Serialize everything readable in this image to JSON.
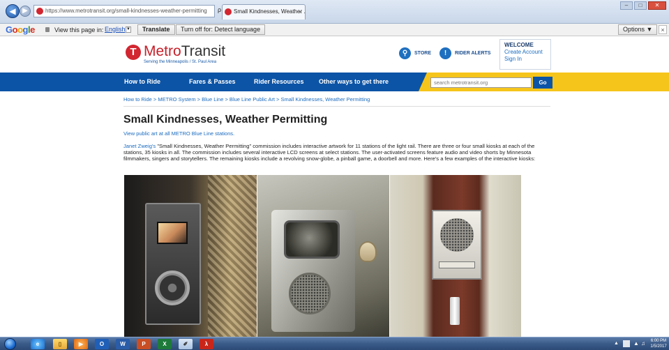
{
  "browser": {
    "url": "https://www.metrotransit.org/small-kindnesses-weather-permitting",
    "address_tools": "ρ ▾ ▩ C",
    "tab_title": "Small Kindnesses, Weather ...",
    "tab_close": "×"
  },
  "translate_bar": {
    "view_label": "View this page in:",
    "language": "English",
    "translate_button": "Translate",
    "turnoff_button": "Turn off for: Detect language",
    "options_button": "Options ▼",
    "close": "×"
  },
  "header": {
    "logo_part1": "Metro",
    "logo_part2": "Transit",
    "logo_letter": "T",
    "tagline": "Serving the Minneapolis / St. Paul Area",
    "store_label": "STORE",
    "alerts_label": "RIDER ALERTS",
    "welcome_title": "WELCOME",
    "create_account": "Create Account",
    "sign_in": "Sign In"
  },
  "nav": {
    "items": [
      "How to Ride",
      "Fares & Passes",
      "Rider Resources",
      "Other ways to get there"
    ],
    "search_placeholder": "search metrotransit.org",
    "search_button": "Go"
  },
  "content": {
    "breadcrumb": "How to Ride > METRO System > Blue Line > Blue Line Public Art > Small Kindnesses, Weather Permitting",
    "title": "Small Kindnesses, Weather Permitting",
    "view_all_link": "View public art at all METRO Blue Line stations.",
    "intro_link": "Janet Zweig's",
    "intro_text": " \"Small Kindnesses, Weather Permitting\" commission includes interactive artwork for 11 stations of the light rail. There are three or four small kiosks at each of the stations, 35 kiosks in all. The commission includes several interactive LCD screens at select stations. The user-activated screens feature audio and video shorts by Minnesota filmmakers, singers and storytellers. The remaining kiosks include a revolving snow-globe, a pinball game, a doorbell and more. Here's a few examples of the interactive kiosks:"
  },
  "taskbar": {
    "icons": [
      "ie-icon",
      "folder-icon",
      "media-icon",
      "outlook-icon",
      "word-icon",
      "powerpoint-icon",
      "excel-icon",
      "paint-icon",
      "pdf-icon"
    ],
    "outlook_letter": "O",
    "word_letter": "W",
    "ppt_letter": "P",
    "excel_letter": "X",
    "time": "6:00 PM",
    "date": "1/5/2017"
  },
  "colors": {
    "brand_red": "#d22630",
    "nav_blue": "#0c54a6",
    "nav_yellow": "#f6c51b",
    "link_blue": "#1a6bbf"
  }
}
